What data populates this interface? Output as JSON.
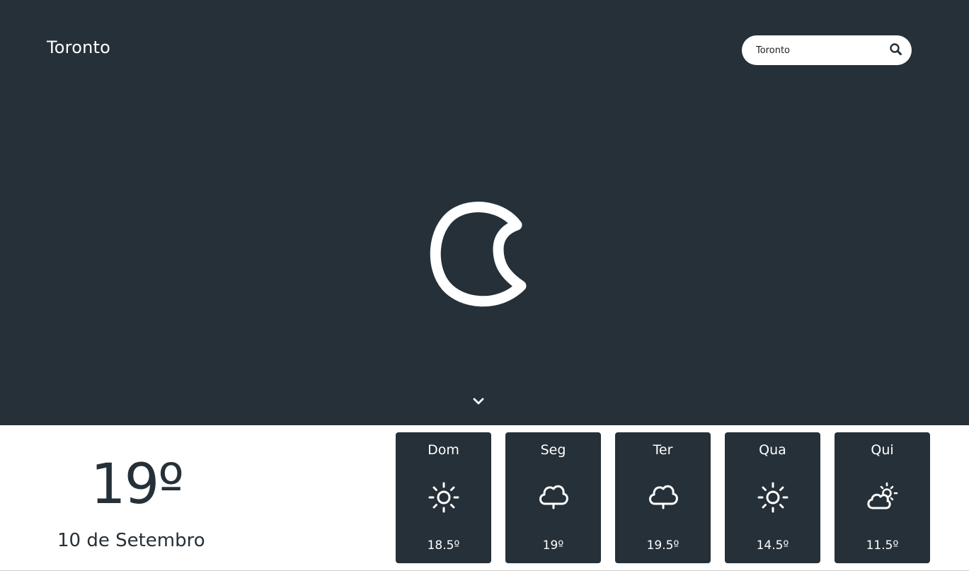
{
  "header": {
    "city": "Toronto",
    "search_value": "Toronto"
  },
  "current": {
    "condition_icon": "moon-icon",
    "temperature": "19º",
    "date": "10 de Setembro"
  },
  "forecast": [
    {
      "day": "Dom",
      "icon": "sun-icon",
      "temp": "18.5º"
    },
    {
      "day": "Seg",
      "icon": "rain-cloud-icon",
      "temp": "19º"
    },
    {
      "day": "Ter",
      "icon": "rain-cloud-icon",
      "temp": "19.5º"
    },
    {
      "day": "Qua",
      "icon": "sun-icon",
      "temp": "14.5º"
    },
    {
      "day": "Qui",
      "icon": "partly-cloudy-icon",
      "temp": "11.5º"
    }
  ],
  "colors": {
    "hero_bg": "#263038",
    "card_bg": "#263038",
    "text_light": "#ffffff",
    "text_dark": "#263038"
  }
}
